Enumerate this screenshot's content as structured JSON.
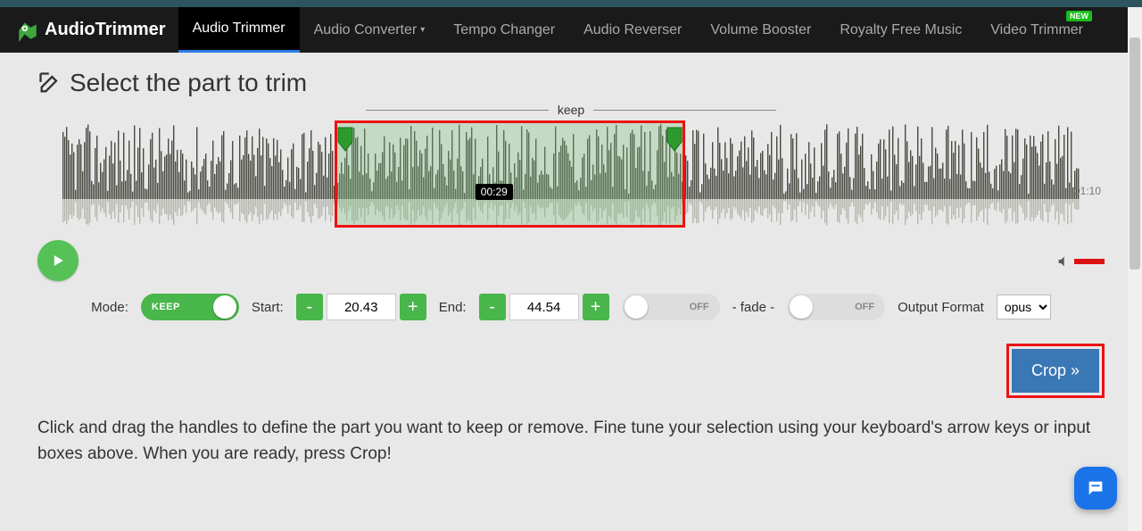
{
  "brand": "AudioTrimmer",
  "nav": {
    "items": [
      {
        "label": "Audio Trimmer",
        "active": true
      },
      {
        "label": "Audio Converter",
        "dropdown": true
      },
      {
        "label": "Tempo Changer"
      },
      {
        "label": "Audio Reverser"
      },
      {
        "label": "Volume Booster"
      },
      {
        "label": "Royalty Free Music"
      },
      {
        "label": "Video Trimmer",
        "badge": "NEW"
      }
    ]
  },
  "heading": "Select the part to trim",
  "keep_label": "keep",
  "selection": {
    "tooltip": "00:29",
    "left_pct": 29.2,
    "width_pct": 34.5
  },
  "duration_label": "01:10",
  "mode": {
    "label": "Mode:",
    "value": "KEEP"
  },
  "start": {
    "label": "Start:",
    "value": "20.43"
  },
  "end": {
    "label": "End:",
    "value": "44.54"
  },
  "toggle_off": "OFF",
  "fade_label": "- fade -",
  "output_format": {
    "label": "Output Format",
    "value": "opus"
  },
  "crop_label": "Crop »",
  "instructions": "Click and drag the handles to define the part you want to keep or remove. Fine tune your selection using your keyboard's arrow keys or input boxes above. When you are ready, press Crop!"
}
